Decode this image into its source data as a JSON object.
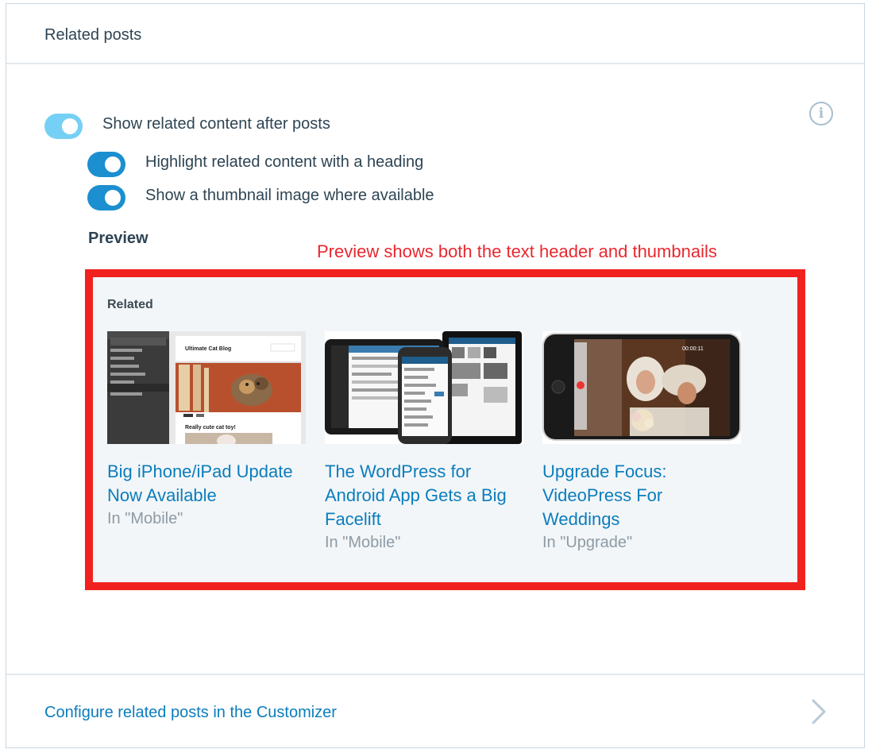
{
  "header": {
    "title": "Related posts"
  },
  "settings": {
    "main_toggle": {
      "label": "Show related content after posts",
      "enabled": true
    },
    "heading_toggle": {
      "label": "Highlight related content with a heading",
      "enabled": true
    },
    "thumbnail_toggle": {
      "label": "Show a thumbnail image where available",
      "enabled": true
    }
  },
  "preview": {
    "heading": "Preview",
    "annotation": "Preview shows both the text header and thumbnails",
    "related_label": "Related",
    "posts": [
      {
        "title": "Big iPhone/iPad Update Now Available",
        "category": "In \"Mobile\"",
        "thumb_text_1": "Ultimate Cat Blog",
        "thumb_text_2": "Really cute cat toy!"
      },
      {
        "title": "The WordPress for Android App Gets a Big Facelift",
        "category": "In \"Mobile\""
      },
      {
        "title": "Upgrade Focus: VideoPress For Weddings",
        "category": "In \"Upgrade\"",
        "thumb_text_1": "00:00:11"
      }
    ]
  },
  "footer": {
    "link": "Configure related posts in the Customizer"
  },
  "icons": {
    "info": "info-icon",
    "chevron": "chevron-right-icon"
  },
  "colors": {
    "accent": "#0b7dbd",
    "toggle_on": "#1b8fcf",
    "toggle_main": "#76d0f5",
    "annotation": "#e8282f"
  }
}
